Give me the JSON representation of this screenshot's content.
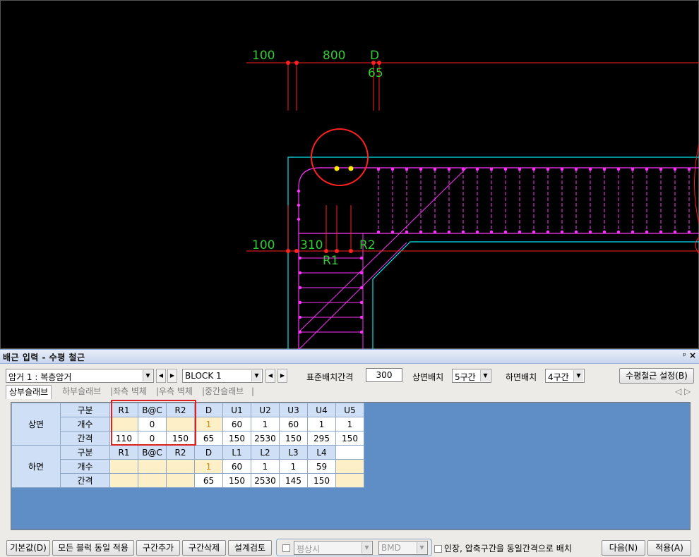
{
  "cad": {
    "dims": {
      "top_left": "100",
      "top_mid": "800",
      "top_d": "D",
      "top_65": "65",
      "left_100": "100",
      "mid_310": "310",
      "r2": "R2",
      "r1": "R1"
    },
    "colors": {
      "dim_red": "#ff2020",
      "text_green": "#33cc33",
      "outline_cyan": "#00e5ee",
      "rebar_magenta": "#ff33ff",
      "dot_yellow": "#ffee00"
    }
  },
  "panel": {
    "title": "배근 입력 - 수평 철근",
    "pin_icon": "pin-icon",
    "close_icon": "close-icon",
    "member_combo": "암거 1 : 복층암거",
    "block_combo": "BLOCK  1",
    "std_spacing_label": "표준배치간격",
    "std_spacing_value": "300",
    "top_layout_label": "상면배치",
    "top_layout_value": "5구간",
    "bottom_layout_label": "하면배치",
    "bottom_layout_value": "4구간",
    "settings_button": "수평철근 설정(B)",
    "tabs": [
      "상부슬래브",
      "하부슬래브",
      "좌측 벽체",
      "우측 벽체",
      "중간슬래브"
    ],
    "tab_sep": "|",
    "scroll_left": "◁",
    "scroll_right": "▷"
  },
  "grid": {
    "top": {
      "section": "상면",
      "rows": [
        {
          "head": "구분",
          "cells": [
            "R1",
            "B@C",
            "R2",
            "D",
            "U1",
            "U2",
            "U3",
            "U4",
            "U5"
          ]
        },
        {
          "head": "개수",
          "cells": [
            "",
            "0",
            "",
            "1",
            "60",
            "1",
            "60",
            "1",
            "1"
          ]
        },
        {
          "head": "간격",
          "cells": [
            "110",
            "0",
            "150",
            "65",
            "150",
            "2530",
            "150",
            "295",
            "150"
          ]
        }
      ]
    },
    "bottom": {
      "section": "하면",
      "rows": [
        {
          "head": "구분",
          "cells": [
            "R1",
            "B@C",
            "R2",
            "D",
            "L1",
            "L2",
            "L3",
            "L4",
            ""
          ]
        },
        {
          "head": "개수",
          "cells": [
            "",
            "",
            "",
            "1",
            "60",
            "1",
            "1",
            "59",
            ""
          ]
        },
        {
          "head": "간격",
          "cells": [
            "",
            "",
            "",
            "65",
            "150",
            "2530",
            "145",
            "150",
            ""
          ]
        }
      ]
    }
  },
  "footer": {
    "default_button": "기본값(D)",
    "same_all_button": "모든 블럭 동일 적용",
    "add_section_button": "구간추가",
    "delete_section_button": "구간삭제",
    "check_design_button": "설계검토",
    "state_combo": "평상시",
    "bmd_combo": "BMD",
    "same_interval_label": "인장, 압축구간을 동일간격으로 배치",
    "next_button": "다음(N)",
    "apply_button": "적용(A)"
  }
}
